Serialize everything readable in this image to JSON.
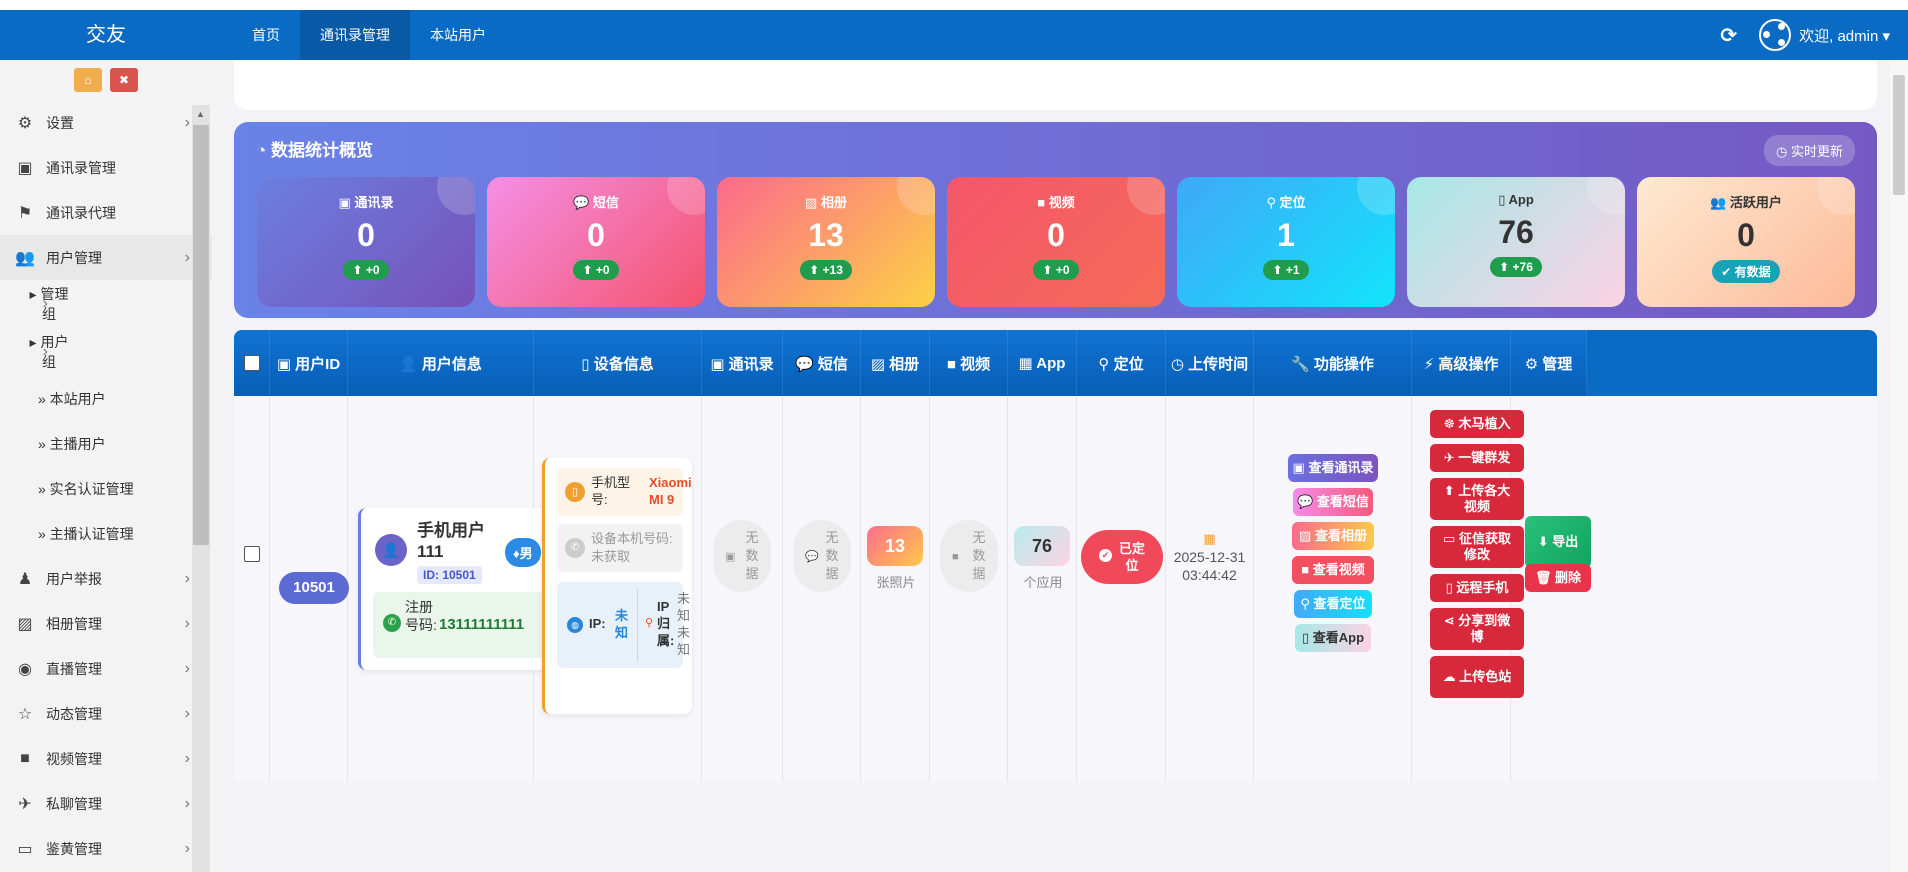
{
  "app": {
    "title": "交友"
  },
  "nav": {
    "items": [
      "首页",
      "通讯录管理",
      "本站用户"
    ]
  },
  "topbar": {
    "refresh_icon": "refresh-icon",
    "welcome": "欢迎, admin ▾"
  },
  "sidebar": {
    "quick": [
      {
        "icon": "home-icon",
        "glyph": "⌂",
        "color": "#f0ad4e"
      },
      {
        "icon": "trash-icon",
        "glyph": "🗑",
        "color": "#d9534f"
      }
    ],
    "items": [
      {
        "label": "设置",
        "glyph": "⚙",
        "arrow": "›"
      },
      {
        "label": "通讯录管理",
        "glyph": "▣",
        "arrow": ""
      },
      {
        "label": "通讯录代理",
        "glyph": "⚑",
        "arrow": ""
      },
      {
        "label": "用户管理",
        "glyph": "👥",
        "arrow": "›"
      },
      {
        "label": "▸ 管理组",
        "arrow": "›"
      },
      {
        "label": "▸ 用户组",
        "arrow": "›"
      },
      {
        "label": "» 本站用户"
      },
      {
        "label": "» 主播用户"
      },
      {
        "label": "» 实名认证管理"
      },
      {
        "label": "» 主播认证管理"
      },
      {
        "label": "用户举报",
        "glyph": "♟",
        "arrow": "›"
      },
      {
        "label": "相册管理",
        "glyph": "▨",
        "arrow": "›"
      },
      {
        "label": "直播管理",
        "glyph": "◉",
        "arrow": "›"
      },
      {
        "label": "动态管理",
        "glyph": "☆",
        "arrow": "›"
      },
      {
        "label": "视频管理",
        "glyph": "■",
        "arrow": "›"
      },
      {
        "label": "私聊管理",
        "glyph": "✈",
        "arrow": "›"
      },
      {
        "label": "鉴黄管理",
        "glyph": "▭",
        "arrow": "›"
      }
    ]
  },
  "stats": {
    "title": "数据统计概览",
    "live": "◷ 实时更新",
    "cards": [
      {
        "label": "▣ 通讯录",
        "value": "0",
        "change": "⬆ +0",
        "bg": "linear-gradient(135deg,#6b7fe0,#7652b8)",
        "chip": "#1f9d4d"
      },
      {
        "label": "💬 短信",
        "value": "0",
        "change": "⬆ +0",
        "bg": "linear-gradient(135deg,#f48fe6,#f4546c)",
        "chip": "#1f9d4d"
      },
      {
        "label": "▨ 相册",
        "value": "13",
        "change": "⬆ +13",
        "bg": "linear-gradient(135deg,#fb6a8c,#fdd146)",
        "chip": "#1f9d4d"
      },
      {
        "label": "■ 视频",
        "value": "0",
        "change": "⬆ +0",
        "bg": "linear-gradient(135deg,#f4566a,#f66a58)",
        "chip": "#1f9d4d"
      },
      {
        "label": "⚲ 定位",
        "value": "1",
        "change": "⬆ +1",
        "bg": "linear-gradient(135deg,#40a8f8,#12e4fa)",
        "chip": "#1f9d4d"
      },
      {
        "label": "▯ App",
        "value": "76",
        "change": "⬆ +76",
        "bg": "linear-gradient(135deg,#a6e8e6,#fcd2e4)",
        "chip": "#1f9d4d",
        "dark": true
      },
      {
        "label": "👥 活跃用户",
        "value": "0",
        "change": "✔ 有数据",
        "bg": "linear-gradient(135deg,#fde9d2,#fdba98)",
        "chip": "#17a2b8",
        "dark": true
      }
    ]
  },
  "table": {
    "headers": [
      "▣ 用户ID",
      "👤 用户信息",
      "▯ 设备信息",
      "▣ 通讯录",
      "💬 短信",
      "▨ 相册",
      "■ 视频",
      "▦ App",
      "⚲ 定位",
      "◷ 上传时间",
      "🔧 功能操作",
      "⚡ 高级操作",
      "⚙ 管理"
    ],
    "row": {
      "id": "10501",
      "user": {
        "name": "手机用户111",
        "id_label": "ID: 10501",
        "gender": "♦男",
        "phone_label": "注册号码:",
        "phone": "13111111111"
      },
      "device": {
        "model_label": "手机型号:",
        "model": "Xiaomi MI 9",
        "number": "设备本机号码: 未获取",
        "ip_label": "IP:",
        "ip": "未知",
        "region_label": "IP归属:",
        "region": "未知未知"
      },
      "nodata": "无数据",
      "album": {
        "count": "13",
        "unit": "张照片"
      },
      "app": {
        "count": "76",
        "unit": "个应用"
      },
      "location": "已定位",
      "upload_time": [
        "2025-12-31",
        "03:44:42"
      ],
      "functions": [
        {
          "label": "▣ 查看通讯录",
          "bg": "linear-gradient(90deg,#6a70e0,#7b54c0)"
        },
        {
          "label": "💬 查看短信",
          "bg": "linear-gradient(90deg,#f68bea,#f45a7a)"
        },
        {
          "label": "▨ 查看相册",
          "bg": "linear-gradient(90deg,#fb6a8c,#fdc94a)"
        },
        {
          "label": "■ 查看视频",
          "bg": "#f25060"
        },
        {
          "label": "⚲ 查看定位",
          "bg": "linear-gradient(90deg,#44a8f8,#14e0fa)"
        },
        {
          "label": "▯ 查看App",
          "bg": "linear-gradient(90deg,#a6e8e6,#fcd2e4)",
          "dark": true
        }
      ],
      "advanced": [
        {
          "label": "☸ 木马植入",
          "h": 28
        },
        {
          "label": "✈ 一键群发",
          "h": 28
        },
        {
          "label": "⬆ 上传各大视频",
          "h": 42
        },
        {
          "label": "▭ 征信获取修改",
          "h": 42
        },
        {
          "label": "▯ 远程手机",
          "h": 28
        },
        {
          "label": "⋖ 分享到微博",
          "h": 42
        },
        {
          "label": "☁ 上传色站",
          "h": 42
        }
      ],
      "manage": [
        {
          "label": "⬇ 导出",
          "bg": "linear-gradient(135deg,#29c27a,#12a35f)"
        },
        {
          "label": "🗑 删除",
          "bg": "#e8344a"
        }
      ]
    }
  }
}
